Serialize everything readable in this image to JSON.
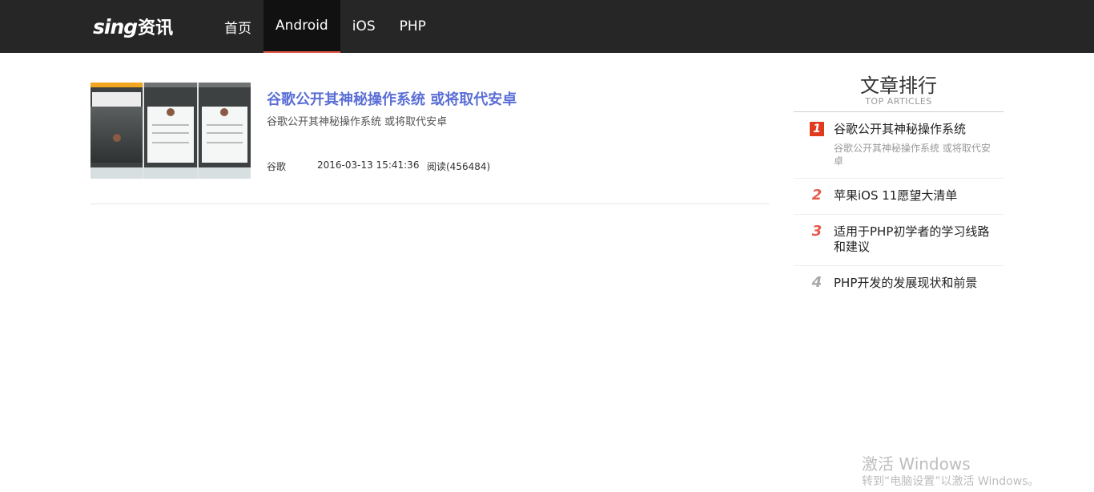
{
  "header": {
    "logo_latin": "sing",
    "logo_cjk": "资讯",
    "nav": [
      {
        "label": "首页",
        "active": false
      },
      {
        "label": "Android",
        "active": true
      },
      {
        "label": "iOS",
        "active": false
      },
      {
        "label": "PHP",
        "active": false
      }
    ]
  },
  "articles": [
    {
      "title": "谷歌公开其神秘操作系统 或将取代安卓",
      "summary": "谷歌公开其神秘操作系统 或将取代安卓",
      "category": "谷歌",
      "date": "2016-03-13 15:41:36",
      "views": "阅读(456484)"
    }
  ],
  "sidebar": {
    "title": "文章排行",
    "subtitle": "TOP ARTICLES",
    "items": [
      {
        "rank": "1",
        "title": "谷歌公开其神秘操作系统",
        "desc": "谷歌公开其神秘操作系统 或将取代安卓"
      },
      {
        "rank": "2",
        "title": "苹果iOS 11愿望大清单",
        "desc": ""
      },
      {
        "rank": "3",
        "title": "适用于PHP初学者的学习线路和建议",
        "desc": ""
      },
      {
        "rank": "4",
        "title": "PHP开发的发展现状和前景",
        "desc": ""
      }
    ]
  },
  "watermark": {
    "main": "激活 Windows",
    "sub": "转到“电脑设置”以激活 Windows。"
  },
  "colors": {
    "topbar": "#262626",
    "accent": "#e7594a",
    "title_link": "#5b6fd6"
  }
}
